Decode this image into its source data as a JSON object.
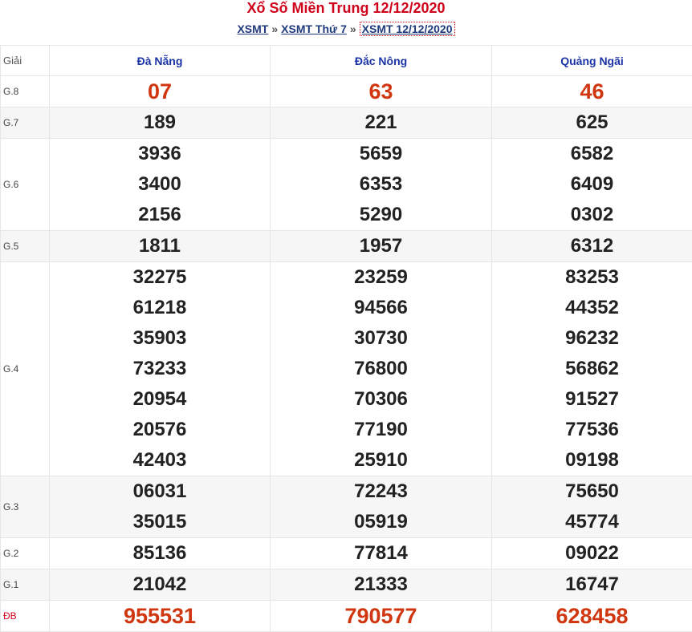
{
  "header": {
    "title": "Xổ Số Miền Trung 12/12/2020",
    "breadcrumb": [
      {
        "label": "XSMT"
      },
      {
        "label": "XSMT Thứ 7"
      },
      {
        "label": "XSMT 12/12/2020"
      }
    ],
    "separator": "»"
  },
  "table": {
    "prize_header": "Giải",
    "provinces": [
      "Đà Nẵng",
      "Đắc Nông",
      "Quảng Ngãi"
    ],
    "rows": [
      {
        "label": "G.8",
        "values": [
          [
            "07"
          ],
          [
            "63"
          ],
          [
            "46"
          ]
        ]
      },
      {
        "label": "G.7",
        "values": [
          [
            "189"
          ],
          [
            "221"
          ],
          [
            "625"
          ]
        ]
      },
      {
        "label": "G.6",
        "values": [
          [
            "3936",
            "3400",
            "2156"
          ],
          [
            "5659",
            "6353",
            "5290"
          ],
          [
            "6582",
            "6409",
            "0302"
          ]
        ]
      },
      {
        "label": "G.5",
        "values": [
          [
            "1811"
          ],
          [
            "1957"
          ],
          [
            "6312"
          ]
        ]
      },
      {
        "label": "G.4",
        "values": [
          [
            "32275",
            "61218",
            "35903",
            "73233",
            "20954",
            "20576",
            "42403"
          ],
          [
            "23259",
            "94566",
            "30730",
            "76800",
            "70306",
            "77190",
            "25910"
          ],
          [
            "83253",
            "44352",
            "96232",
            "56862",
            "91527",
            "77536",
            "09198"
          ]
        ]
      },
      {
        "label": "G.3",
        "values": [
          [
            "06031",
            "35015"
          ],
          [
            "72243",
            "05919"
          ],
          [
            "75650",
            "45774"
          ]
        ]
      },
      {
        "label": "G.2",
        "values": [
          [
            "85136"
          ],
          [
            "77814"
          ],
          [
            "09022"
          ]
        ]
      },
      {
        "label": "G.1",
        "values": [
          [
            "21042"
          ],
          [
            "21333"
          ],
          [
            "16747"
          ]
        ]
      },
      {
        "label": "ĐB",
        "values": [
          [
            "955531"
          ],
          [
            "790577"
          ],
          [
            "628458"
          ]
        ]
      }
    ]
  },
  "colors": {
    "title": "#d0021b",
    "link": "#1f3a7a",
    "province_header": "#1a33a6",
    "highlight_number": "#d0360f",
    "alt_row_bg": "#f6f6f6"
  }
}
